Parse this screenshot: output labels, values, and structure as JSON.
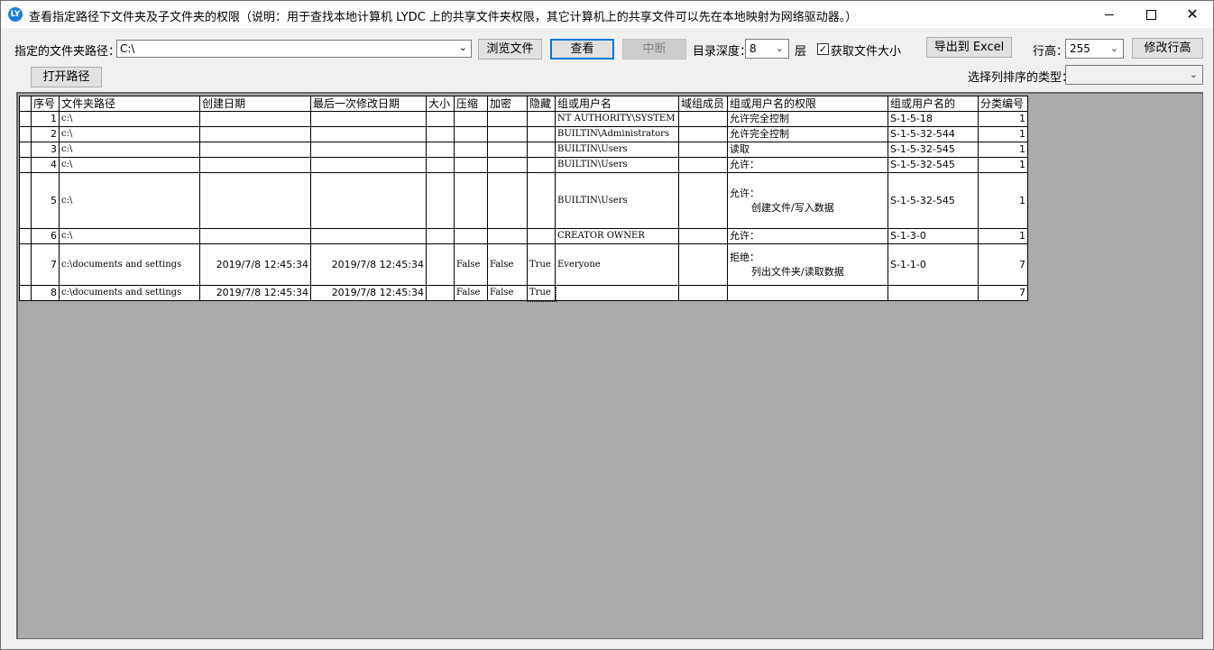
{
  "window": {
    "title": "查看指定路径下文件夹及子文件夹的权限（说明：用于查找本地计算机 LYDC 上的共享文件夹权限，其它计算机上的共享文件可以先在本地映射为网络驱动器。）",
    "app_icon_text": "LY",
    "minimize": "",
    "maximize": "",
    "close": "✕"
  },
  "toolbar": {
    "path_label": "指定的文件夹路径：",
    "path_value": "C:\\",
    "browse_label": "浏览文件",
    "view_label": "查看",
    "stop_label": "中断",
    "depth_label": "目录深度：",
    "depth_value": "8",
    "depth_unit": "层",
    "size_checkbox_label": "获取文件大小",
    "size_checked": true,
    "export_label": "导出到 Excel",
    "row_height_label": "行高：",
    "row_height_value": "255",
    "modify_row_height_label": "修改行高",
    "open_path_label": "打开路径",
    "sort_type_label": "选择列排序的类型：",
    "sort_type_value": ""
  },
  "grid": {
    "columns": [
      "序号",
      "文件夹路径",
      "创建日期",
      "最后一次修改日期",
      "大小",
      "压缩",
      "加密",
      "隐藏",
      "组或用户名",
      "域组成员",
      "组或用户名的权限",
      "组或用户名的",
      "分类编号"
    ],
    "rows": [
      {
        "no": "1",
        "path": "c:\\",
        "created": "",
        "modified": "",
        "size": "",
        "compressed": "",
        "encrypted": "",
        "hidden": "",
        "user": "NT AUTHORITY\\SYSTEM",
        "domain_member": "",
        "perm_title": "允许完全控制",
        "perm_detail": "",
        "sid": "S-1-5-18",
        "category": "1"
      },
      {
        "no": "2",
        "path": "c:\\",
        "created": "",
        "modified": "",
        "size": "",
        "compressed": "",
        "encrypted": "",
        "hidden": "",
        "user": "BUILTIN\\Administrators",
        "domain_member": "",
        "perm_title": "允许完全控制",
        "perm_detail": "",
        "sid": "S-1-5-32-544",
        "category": "1"
      },
      {
        "no": "3",
        "path": "c:\\",
        "created": "",
        "modified": "",
        "size": "",
        "compressed": "",
        "encrypted": "",
        "hidden": "",
        "user": "BUILTIN\\Users",
        "domain_member": "",
        "perm_title": "读取",
        "perm_detail": "",
        "sid": "S-1-5-32-545",
        "category": "1"
      },
      {
        "no": "4",
        "path": "c:\\",
        "created": "",
        "modified": "",
        "size": "",
        "compressed": "",
        "encrypted": "",
        "hidden": "",
        "user": "BUILTIN\\Users",
        "domain_member": "",
        "perm_title": "允许：",
        "perm_detail": "",
        "sid": "S-1-5-32-545",
        "category": "1"
      },
      {
        "no": "5",
        "path": "c:\\",
        "created": "",
        "modified": "",
        "size": "",
        "compressed": "",
        "encrypted": "",
        "hidden": "",
        "user": "BUILTIN\\Users",
        "domain_member": "",
        "perm_title": "允许：",
        "perm_detail": "创建文件/写入数据",
        "sid": "S-1-5-32-545",
        "category": "1"
      },
      {
        "no": "6",
        "path": "c:\\",
        "created": "",
        "modified": "",
        "size": "",
        "compressed": "",
        "encrypted": "",
        "hidden": "",
        "user": "CREATOR OWNER",
        "domain_member": "",
        "perm_title": "允许：",
        "perm_detail": "",
        "sid": "S-1-3-0",
        "category": "1"
      },
      {
        "no": "7",
        "path": "c:\\documents and settings",
        "created": "2019/7/8 12:45:34",
        "modified": "2019/7/8 12:45:34",
        "size": "",
        "compressed": "False",
        "encrypted": "False",
        "hidden": "True",
        "user": "Everyone",
        "domain_member": "",
        "perm_title": "拒绝：",
        "perm_detail": "列出文件夹/读取数据",
        "sid": "S-1-1-0",
        "category": "7"
      },
      {
        "no": "8",
        "path": "c:\\documents and settings",
        "created": "2019/7/8 12:45:34",
        "modified": "2019/7/8 12:45:34",
        "size": "",
        "compressed": "False",
        "encrypted": "False",
        "hidden": "True",
        "user": "",
        "domain_member": "",
        "perm_title": "",
        "perm_detail": "",
        "sid": "",
        "category": "7"
      }
    ]
  }
}
